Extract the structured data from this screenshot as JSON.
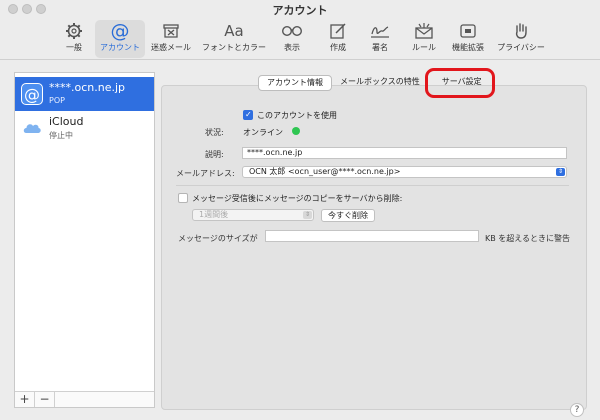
{
  "window": {
    "title": "アカウント"
  },
  "toolbar": {
    "items": [
      {
        "label": "一般",
        "icon": "gear-icon"
      },
      {
        "label": "アカウント",
        "icon": "at-sign-icon"
      },
      {
        "label": "迷惑メール",
        "icon": "junk-mail-icon"
      },
      {
        "label": "フォントとカラー",
        "icon": "fonts-icon"
      },
      {
        "label": "表示",
        "icon": "glasses-icon"
      },
      {
        "label": "作成",
        "icon": "compose-icon"
      },
      {
        "label": "署名",
        "icon": "signature-icon"
      },
      {
        "label": "ルール",
        "icon": "rules-envelope-icon"
      },
      {
        "label": "機能拡張",
        "icon": "extension-icon"
      },
      {
        "label": "プライバシー",
        "icon": "hand-icon"
      }
    ],
    "fonts_glyph": "Aa"
  },
  "sidebar": {
    "accounts": [
      {
        "name": "****.ocn.ne.jp",
        "type": "POP",
        "icon": "at-sign-icon"
      },
      {
        "name": "iCloud",
        "type": "停止中",
        "icon": "icloud-icon"
      }
    ],
    "add_label": "+",
    "remove_label": "−"
  },
  "tabs": {
    "items": [
      "アカウント情報",
      "メールボックスの特性",
      "サーバ設定"
    ],
    "selected": "アカウント情報",
    "highlight_color": "#e2161c"
  },
  "form": {
    "enable_account_label": "このアカウントを使用",
    "status_label": "状況:",
    "status_value": "オンライン",
    "status_color": "#2fc652",
    "description_label": "説明:",
    "description_value": "****.ocn.ne.jp",
    "email_label": "メールアドレス:",
    "email_value": "OCN 太郎 <ocn_user@****.ocn.ne.jp>",
    "delete_copy_label": "メッセージ受信後にメッセージのコピーをサーバから削除:",
    "delete_period_value": "1週間後",
    "delete_now_label": "今すぐ削除",
    "size_warning_prefix": "メッセージのサイズが",
    "size_warning_value": "",
    "size_warning_suffix": "KB を超えるときに警告",
    "help_label": "?"
  },
  "colors": {
    "accent": "#2f6fe0"
  }
}
